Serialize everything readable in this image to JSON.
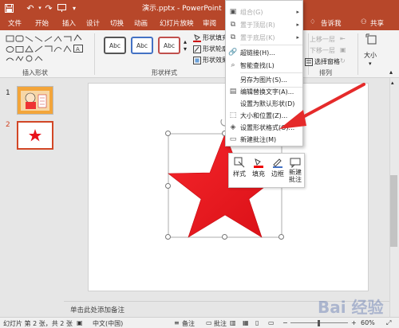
{
  "titlebar": {
    "title": "演示.pptx - PowerPoint",
    "save_icon": "save-icon",
    "undo_icon": "undo-icon",
    "redo_icon": "redo-icon",
    "slideshow_icon": "slideshow-icon",
    "customize_icon": "chevron-down-icon"
  },
  "tabs": [
    "文件",
    "开始",
    "插入",
    "设计",
    "切换",
    "动画",
    "幻灯片放映",
    "审阅"
  ],
  "tabs_right": {
    "tell_me": "告诉我",
    "share": "共享"
  },
  "ribbon": {
    "insert_shapes_label": "插入形状",
    "shape_styles_label": "形状样式",
    "arrange_label": "排列",
    "style_thumb_text": "Abc",
    "shape_fill": "形状填充",
    "shape_outline": "形状轮廓",
    "shape_effects": "形状效果",
    "bring_forward": "上移一层",
    "send_backward": "下移一层",
    "selection_pane": "选择窗格",
    "size": "大小"
  },
  "context_menu": {
    "items": [
      {
        "label": "组合(G)",
        "submenu": true,
        "disabled": true
      },
      {
        "label": "置于顶层(R)",
        "submenu": true,
        "disabled": true
      },
      {
        "label": "置于底层(K)",
        "submenu": true,
        "disabled": true
      },
      {
        "label": "超链接(H)...",
        "submenu": false,
        "disabled": false
      },
      {
        "label": "智能查找(L)",
        "submenu": false,
        "disabled": false
      },
      {
        "label": "另存为图片(S)...",
        "submenu": false,
        "disabled": false
      },
      {
        "label": "编辑替换文字(A)...",
        "submenu": false,
        "disabled": false
      },
      {
        "label": "设置为默认形状(D)",
        "submenu": false,
        "disabled": false
      },
      {
        "label": "大小和位置(Z)...",
        "submenu": false,
        "disabled": false
      },
      {
        "label": "设置形状格式(O)...",
        "submenu": false,
        "disabled": false
      },
      {
        "label": "新建批注(M)",
        "submenu": false,
        "disabled": false
      }
    ]
  },
  "mini_toolbar": {
    "style": "样式",
    "fill": "填充",
    "outline": "边框",
    "new_comment_line1": "新建",
    "new_comment_line2": "批注"
  },
  "slides": [
    {
      "number": "1"
    },
    {
      "number": "2"
    }
  ],
  "notes_placeholder": "单击此处添加备注",
  "statusbar": {
    "slide_info": "幻灯片 第 2 张，共 2 张",
    "language": "中文(中国)",
    "notes": "备注",
    "comments": "批注",
    "zoom": "60%"
  },
  "watermark": "Bai 经验",
  "colors": {
    "accent": "#b7472a",
    "star": "#e8131b",
    "arrow": "#e52a2a"
  }
}
